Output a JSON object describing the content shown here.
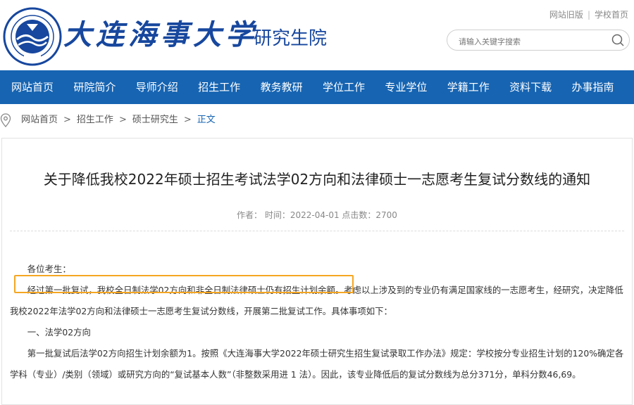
{
  "header": {
    "logo_text": "大连海事大学",
    "logo_sub": "研究生院",
    "emblem_text": "DALIAN MARITIME UNIVERSITY",
    "emblem_year": "1909",
    "top_links": [
      "网站旧版",
      "学校首页"
    ],
    "search_placeholder": "请输入关键字搜索"
  },
  "nav": {
    "items": [
      "网站首页",
      "研院简介",
      "导师介绍",
      "招生工作",
      "教务教研",
      "学位工作",
      "专业学位",
      "学籍工作",
      "资料下载",
      "办事指南"
    ]
  },
  "breadcrumb": {
    "items": [
      "网站首页",
      "招生工作",
      "硕士研究生"
    ],
    "current": "正文",
    "arrow": ">"
  },
  "article": {
    "title": "关于降低我校2022年硕士招生考试法学02方向和法律硕士一志愿考生复试分数线的通知",
    "meta": "作者： 时间：2022-04-01 点击数：2700",
    "greeting": "各位考生：",
    "para1": "经过第一批复试，我校全日制法学02方向和非全日制法律硕士仍有招生计划余额。考虑以上涉及到的专业仍有满足国家线的一志愿考生，经研究，决定降低我校2022年法学02方向和法律硕士一志愿考生复试分数线，开展第二批复试工作。具体事项如下：",
    "section1": "一、法学02方向",
    "para2": "第一批复试后法学02方向招生计划余额为1。按照《大连海事大学2022年硕士研究生招生复试录取工作办法》规定：学校按分专业招生计划的120%确定各学科（专业）/类别（领域）或研究方向的“复试基本人数”（非整数采用进 1 法）。因此，该专业降低后的复试分数线为总分371分，单科分数46,69。"
  },
  "colors": {
    "brand_blue": "#17479e",
    "nav_blue": "#1664b2",
    "highlight": "#f5a623"
  }
}
